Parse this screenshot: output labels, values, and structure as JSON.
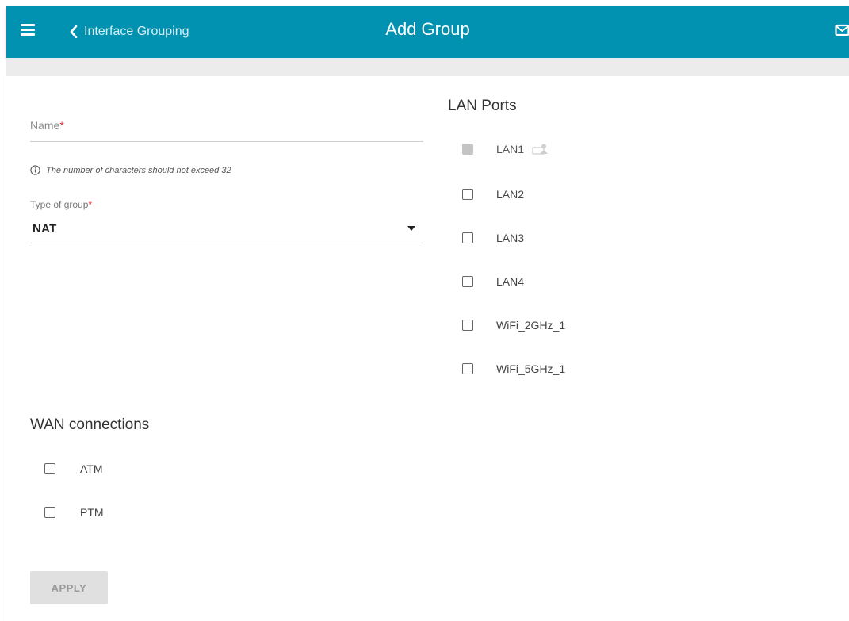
{
  "header": {
    "back_label": "Interface Grouping",
    "title": "Add Group",
    "accent_color": "#0092b0"
  },
  "form": {
    "name": {
      "label": "Name",
      "required_mark": "*",
      "value": ""
    },
    "hint": "The number of characters should not exceed 32",
    "group_type": {
      "label": "Type of group",
      "required_mark": "*",
      "value": "NAT"
    }
  },
  "lan_ports": {
    "title": "LAN Ports",
    "items": [
      {
        "label": "LAN1",
        "checked": false,
        "disabled": true,
        "icon": "connected-device-icon"
      },
      {
        "label": "LAN2",
        "checked": false,
        "disabled": false
      },
      {
        "label": "LAN3",
        "checked": false,
        "disabled": false
      },
      {
        "label": "LAN4",
        "checked": false,
        "disabled": false
      },
      {
        "label": "WiFi_2GHz_1",
        "checked": false,
        "disabled": false
      },
      {
        "label": "WiFi_5GHz_1",
        "checked": false,
        "disabled": false
      }
    ]
  },
  "wan": {
    "title": "WAN connections",
    "items": [
      {
        "label": "ATM",
        "checked": false
      },
      {
        "label": "PTM",
        "checked": false
      }
    ]
  },
  "actions": {
    "apply_label": "APPLY",
    "apply_enabled": false
  }
}
